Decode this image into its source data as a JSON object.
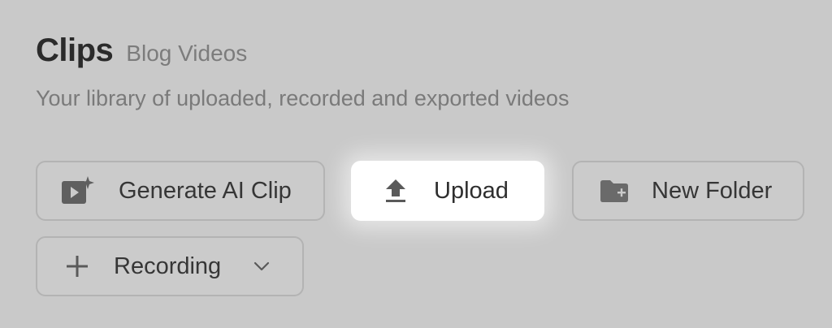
{
  "header": {
    "title": "Clips",
    "tag": "Blog Videos",
    "description": "Your library of uploaded, recorded and exported videos"
  },
  "actions": {
    "generate_label": "Generate AI Clip",
    "upload_label": "Upload",
    "new_folder_label": "New Folder",
    "recording_label": "Recording"
  },
  "icons": {
    "generate": "video-sparkle-icon",
    "upload": "upload-icon",
    "new_folder": "folder-plus-icon",
    "recording": "plus-icon",
    "dropdown": "chevron-down-icon"
  },
  "colors": {
    "background": "#c9c9c9",
    "highlight": "#ffffff",
    "text": "#363636",
    "muted": "#7a7a7a"
  }
}
